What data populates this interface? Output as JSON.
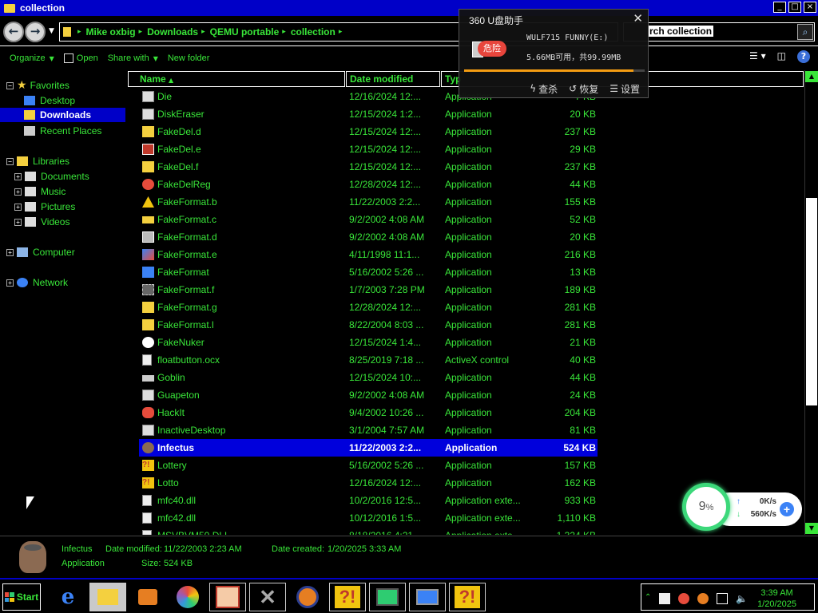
{
  "window": {
    "title": "collection"
  },
  "address": {
    "crumbs": [
      "Mike oxbig",
      "Downloads",
      "QEMU portable",
      "collection"
    ],
    "search_text": "rch collection"
  },
  "toolbar": {
    "organize": "Organize",
    "open": "Open",
    "share_with": "Share with",
    "new_folder": "New folder"
  },
  "nav": {
    "favorites": "Favorites",
    "desktop": "Desktop",
    "downloads": "Downloads",
    "recent": "Recent Places",
    "libraries": "Libraries",
    "documents": "Documents",
    "music": "Music",
    "pictures": "Pictures",
    "videos": "Videos",
    "computer": "Computer",
    "network": "Network"
  },
  "columns": {
    "name": "Name",
    "date": "Date modified",
    "type": "Typ",
    "size": ""
  },
  "files": [
    {
      "name": "Die",
      "date": "12/16/2024 12:...",
      "type": "Application",
      "size": "7 KB",
      "icon": "window"
    },
    {
      "name": "DiskEraser",
      "date": "12/15/2024 1:2...",
      "type": "Application",
      "size": "20 KB",
      "icon": "window"
    },
    {
      "name": "FakeDel.d",
      "date": "12/15/2024 12:...",
      "type": "Application",
      "size": "237 KB",
      "icon": "folder"
    },
    {
      "name": "FakeDel.e",
      "date": "12/15/2024 12:...",
      "type": "Application",
      "size": "29 KB",
      "icon": "eraser"
    },
    {
      "name": "FakeDel.f",
      "date": "12/15/2024 12:...",
      "type": "Application",
      "size": "237 KB",
      "icon": "folder"
    },
    {
      "name": "FakeDelReg",
      "date": "12/28/2024 12:...",
      "type": "Application",
      "size": "44 KB",
      "icon": "globe"
    },
    {
      "name": "FakeFormat.b",
      "date": "11/22/2003 2:2...",
      "type": "Application",
      "size": "155 KB",
      "icon": "warning"
    },
    {
      "name": "FakeFormat.c",
      "date": "9/2/2002 4:08 AM",
      "type": "Application",
      "size": "52 KB",
      "icon": "folder-open"
    },
    {
      "name": "FakeFormat.d",
      "date": "9/2/2002 4:08 AM",
      "type": "Application",
      "size": "20 KB",
      "icon": "camera"
    },
    {
      "name": "FakeFormat.e",
      "date": "4/11/1998 11:1...",
      "type": "Application",
      "size": "216 KB",
      "icon": "wand"
    },
    {
      "name": "FakeFormat",
      "date": "5/16/2002 5:26 ...",
      "type": "Application",
      "size": "13 KB",
      "icon": "setup"
    },
    {
      "name": "FakeFormat.f",
      "date": "1/7/2003 7:28 PM",
      "type": "Application",
      "size": "189 KB",
      "icon": "chip"
    },
    {
      "name": "FakeFormat.g",
      "date": "12/28/2024 12:...",
      "type": "Application",
      "size": "281 KB",
      "icon": "folder"
    },
    {
      "name": "FakeFormat.l",
      "date": "8/22/2004 8:03 ...",
      "type": "Application",
      "size": "281 KB",
      "icon": "folder"
    },
    {
      "name": "FakeNuker",
      "date": "12/15/2024 1:4...",
      "type": "Application",
      "size": "21 KB",
      "icon": "play"
    },
    {
      "name": "floatbutton.ocx",
      "date": "8/25/2019 7:18 ...",
      "type": "ActiveX control",
      "size": "40 KB",
      "icon": "doc"
    },
    {
      "name": "Goblin",
      "date": "12/15/2024 10:...",
      "type": "Application",
      "size": "44 KB",
      "icon": "goblin"
    },
    {
      "name": "Guapeton",
      "date": "9/2/2002 4:08 AM",
      "type": "Application",
      "size": "24 KB",
      "icon": "window"
    },
    {
      "name": "HackIt",
      "date": "9/4/2002 10:26 ...",
      "type": "Application",
      "size": "204 KB",
      "icon": "hack"
    },
    {
      "name": "InactiveDesktop",
      "date": "3/1/2004 7:57 AM",
      "type": "Application",
      "size": "81 KB",
      "icon": "window"
    },
    {
      "name": "Infectus",
      "date": "11/22/2003 2:2...",
      "type": "Application",
      "size": "524 KB",
      "icon": "face"
    },
    {
      "name": "Lottery",
      "date": "5/16/2002 5:26 ...",
      "type": "Application",
      "size": "157 KB",
      "icon": "question"
    },
    {
      "name": "Lotto",
      "date": "12/16/2024 12:...",
      "type": "Application",
      "size": "162 KB",
      "icon": "question"
    },
    {
      "name": "mfc40.dll",
      "date": "10/2/2016 12:5...",
      "type": "Application exte...",
      "size": "933 KB",
      "icon": "doc"
    },
    {
      "name": "mfc42.dll",
      "date": "10/12/2016 1:5...",
      "type": "Application exte...",
      "size": "1,110 KB",
      "icon": "doc"
    },
    {
      "name": "MSVBVM50.DLL",
      "date": "8/18/2016 4:21 ...",
      "type": "Application exte...",
      "size": "1,324 KB",
      "icon": "doc"
    }
  ],
  "selected_index": 20,
  "details": {
    "name": "Infectus",
    "type": "Application",
    "modified_label": "Date modified:",
    "modified": "11/22/2003 2:23 AM",
    "created_label": "Date created:",
    "created": "1/20/2025 3:33 AM",
    "size_label": "Size:",
    "size": "524 KB"
  },
  "popup": {
    "title": "360 U盘助手",
    "badge": "危险",
    "drive": "WULF715 FUNNY(E:)",
    "space": "5.66MB可用，共99.99MB",
    "used_fraction": 0.94,
    "actions": [
      "查杀",
      "恢复",
      "设置"
    ]
  },
  "netwidget": {
    "percent": "9",
    "percent_sign": "%",
    "up": "0K/s",
    "down": "560K/s"
  },
  "taskbar": {
    "start": "Start",
    "time": "3:39 AM",
    "date": "1/20/2025"
  },
  "colors": {
    "text": "#39e639",
    "selection": "#0000dc",
    "titlebar": "#0000c8"
  }
}
